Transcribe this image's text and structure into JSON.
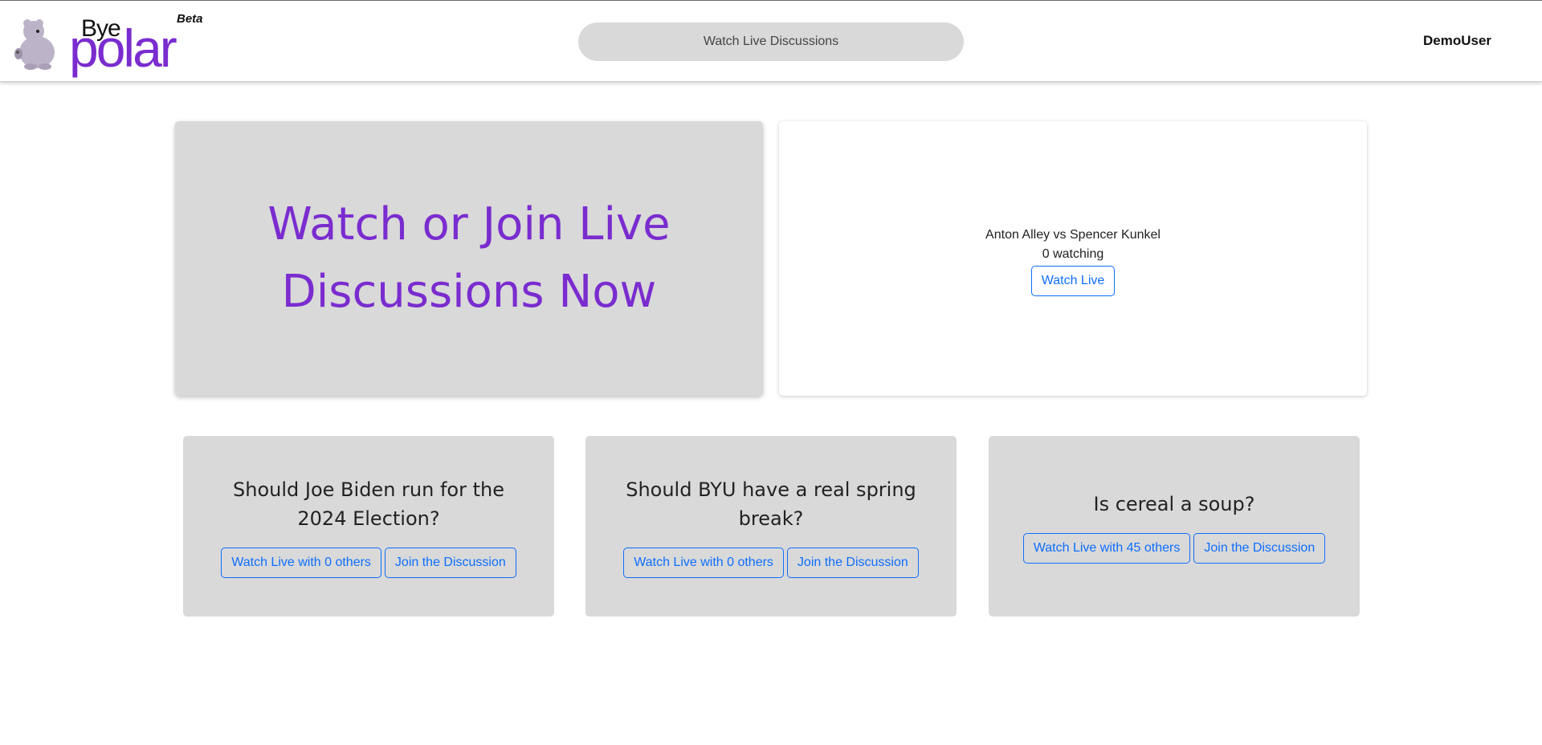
{
  "header": {
    "logo": {
      "top_word": "Bye",
      "main_word": "polar",
      "tag": "Beta"
    },
    "search_placeholder": "Watch Live Discussions",
    "username": "DemoUser"
  },
  "hero": {
    "title": "Watch or Join Live Discussions Now"
  },
  "featured_live": {
    "title": "Anton Alley vs Spencer Kunkel",
    "watching": "0 watching",
    "button": "Watch Live"
  },
  "topics": [
    {
      "question": "Should Joe Biden run for the 2024 Election?",
      "watch_button": "Watch Live with 0 others",
      "join_button": "Join the Discussion"
    },
    {
      "question": "Should BYU have a real spring break?",
      "watch_button": "Watch Live with 0 others",
      "join_button": "Join the Discussion"
    },
    {
      "question": "Is cereal a soup?",
      "watch_button": "Watch Live with 45 others",
      "join_button": "Join the Discussion"
    }
  ],
  "colors": {
    "brand_purple": "#7a2ccf",
    "card_gray": "#d9d9d9",
    "button_blue": "#0d6efd"
  },
  "icons": {
    "logo_mascot": "polar-bear-icon"
  }
}
